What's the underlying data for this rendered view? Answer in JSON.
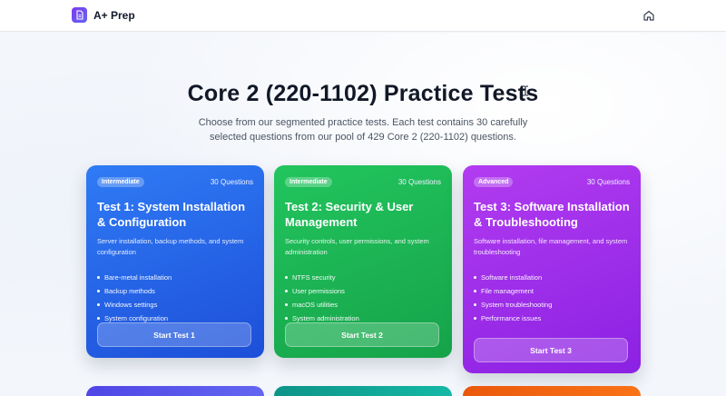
{
  "header": {
    "brand_name": "A+ Prep",
    "brand_icon": "document-icon",
    "home_icon": "home-icon"
  },
  "hero": {
    "title": "Core 2 (220-1102) Practice Tests",
    "subtitle": "Choose from our segmented practice tests. Each test contains 30 carefully selected questions from our pool of 429 Core 2 (220-1102) questions."
  },
  "tests": [
    {
      "level": "Intermediate",
      "questions": "30 Questions",
      "title": "Test 1: System Installation & Configuration",
      "description": "Server installation, backup methods, and system configuration",
      "topics": [
        "Bare-metal installation",
        "Backup methods",
        "Windows settings",
        "System configuration"
      ],
      "button": "Start Test 1",
      "color": "#2563eb"
    },
    {
      "level": "Intermediate",
      "questions": "30 Questions",
      "title": "Test 2: Security & User Management",
      "description": "Security controls, user permissions, and system administration",
      "topics": [
        "NTFS security",
        "User permissions",
        "macOS utilities",
        "System administration"
      ],
      "button": "Start Test 2",
      "color": "#16a34a"
    },
    {
      "level": "Advanced",
      "questions": "30 Questions",
      "title": "Test 3: Software Installation & Troubleshooting",
      "description": "Software installation, file management, and system troubleshooting",
      "topics": [
        "Software installation",
        "File management",
        "System troubleshooting",
        "Performance issues"
      ],
      "button": "Start Test 3",
      "color": "#9333ea"
    }
  ]
}
